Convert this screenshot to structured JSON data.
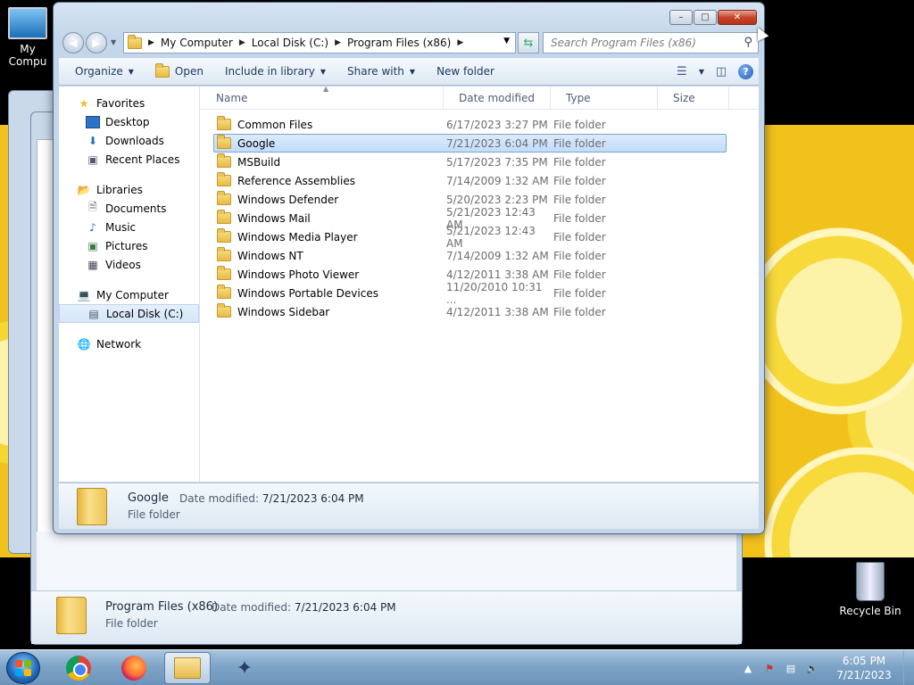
{
  "desktop": {
    "icons": [
      {
        "label": "My Compu"
      },
      {
        "label": "Recycle Bin"
      }
    ]
  },
  "bg_window": {
    "details": {
      "name": "Program Files (x86)",
      "modified_label": "Date modified:",
      "modified": "7/21/2023 6:04 PM",
      "type": "File folder"
    }
  },
  "window": {
    "caption": {
      "minimize": "–",
      "maximize": "□",
      "close": "✕"
    },
    "address": {
      "crumbs": [
        "My Computer",
        "Local Disk (C:)",
        "Program Files (x86)"
      ]
    },
    "search": {
      "placeholder": "Search Program Files (x86)"
    },
    "toolbar": {
      "organize": "Organize",
      "open": "Open",
      "include": "Include in library",
      "share": "Share with",
      "newfolder": "New folder"
    },
    "navpane": {
      "favorites": "Favorites",
      "desktop": "Desktop",
      "downloads": "Downloads",
      "recent": "Recent Places",
      "libraries": "Libraries",
      "documents": "Documents",
      "music": "Music",
      "pictures": "Pictures",
      "videos": "Videos",
      "mycomputer": "My Computer",
      "localdisk": "Local Disk (C:)",
      "network": "Network"
    },
    "columns": {
      "name": "Name",
      "date": "Date modified",
      "type": "Type",
      "size": "Size"
    },
    "files": [
      {
        "name": "Common Files",
        "date": "6/17/2023 3:27 PM",
        "type": "File folder"
      },
      {
        "name": "Google",
        "date": "7/21/2023 6:04 PM",
        "type": "File folder"
      },
      {
        "name": "MSBuild",
        "date": "5/17/2023 7:35 PM",
        "type": "File folder"
      },
      {
        "name": "Reference Assemblies",
        "date": "7/14/2009 1:32 AM",
        "type": "File folder"
      },
      {
        "name": "Windows Defender",
        "date": "5/20/2023 2:23 PM",
        "type": "File folder"
      },
      {
        "name": "Windows Mail",
        "date": "5/21/2023 12:43 AM",
        "type": "File folder"
      },
      {
        "name": "Windows Media Player",
        "date": "5/21/2023 12:43 AM",
        "type": "File folder"
      },
      {
        "name": "Windows NT",
        "date": "7/14/2009 1:32 AM",
        "type": "File folder"
      },
      {
        "name": "Windows Photo Viewer",
        "date": "4/12/2011 3:38 AM",
        "type": "File folder"
      },
      {
        "name": "Windows Portable Devices",
        "date": "11/20/2010 10:31 ...",
        "type": "File folder"
      },
      {
        "name": "Windows Sidebar",
        "date": "4/12/2011 3:38 AM",
        "type": "File folder"
      }
    ],
    "details": {
      "name": "Google",
      "modified_label": "Date modified:",
      "modified": "7/21/2023 6:04 PM",
      "type": "File folder"
    }
  },
  "taskbar": {
    "clock_time": "6:05 PM",
    "clock_date": "7/21/2023"
  }
}
